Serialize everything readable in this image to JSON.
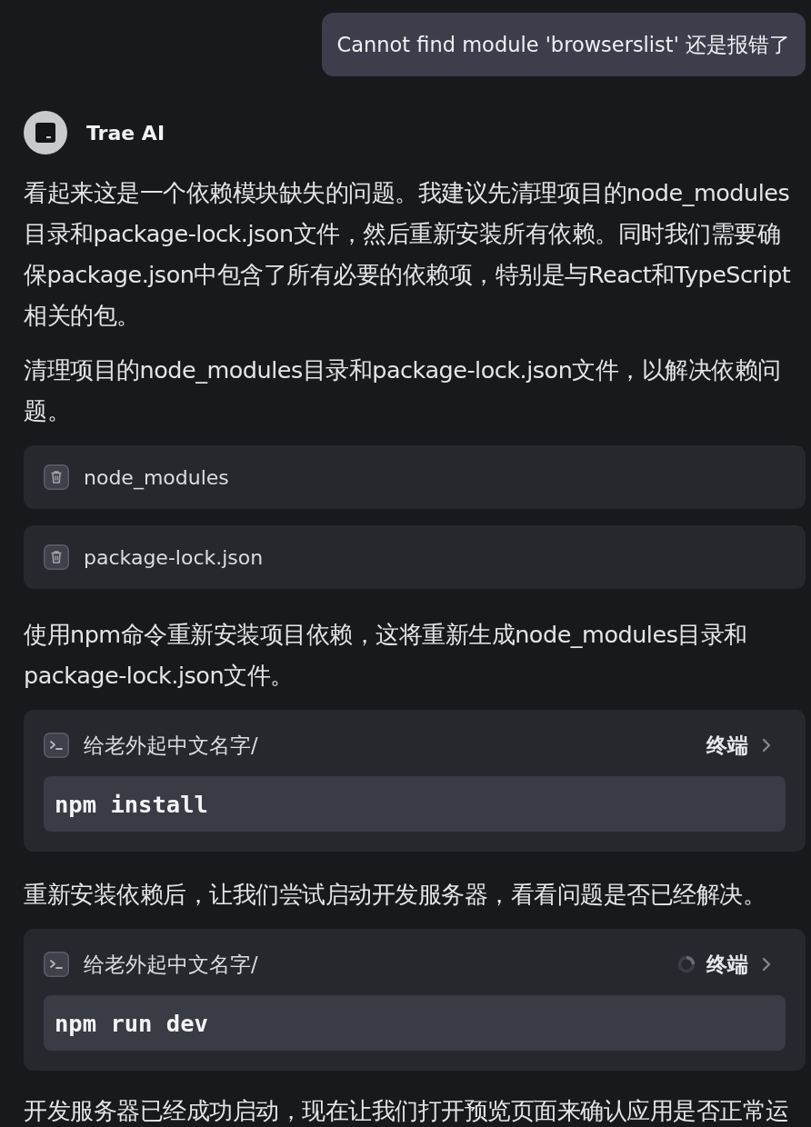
{
  "user_message": {
    "text": "Cannot find module 'browserslist' 还是报错了"
  },
  "assistant": {
    "name": "Trae AI"
  },
  "blocks": [
    {
      "kind": "paragraph",
      "text": "看起来这是一个依赖模块缺失的问题。我建议先清理项目的node_modules目录和package-lock.json文件，然后重新安装所有依赖。同时我们需要确保package.json中包含了所有必要的依赖项，特别是与React和TypeScript相关的包。"
    },
    {
      "kind": "paragraph",
      "text": "清理项目的node_modules目录和package-lock.json文件，以解决依赖问题。"
    },
    {
      "kind": "file",
      "name": "node_modules"
    },
    {
      "kind": "file",
      "name": "package-lock.json"
    },
    {
      "kind": "paragraph",
      "text": "使用npm命令重新安装项目依赖，这将重新生成node_modules目录和package-lock.json文件。"
    },
    {
      "kind": "terminal",
      "path": "给老外起中文名字/",
      "label": "终端",
      "command": "npm install",
      "running": false
    },
    {
      "kind": "paragraph",
      "text": "重新安装依赖后，让我们尝试启动开发服务器，看看问题是否已经解决。"
    },
    {
      "kind": "terminal",
      "path": "给老外起中文名字/",
      "label": "终端",
      "command": "npm run dev",
      "running": true
    },
    {
      "kind": "paragraph",
      "text": "开发服务器已经成功启动，现在让我们打开预览页面来确认应用是否正常运"
    }
  ]
}
